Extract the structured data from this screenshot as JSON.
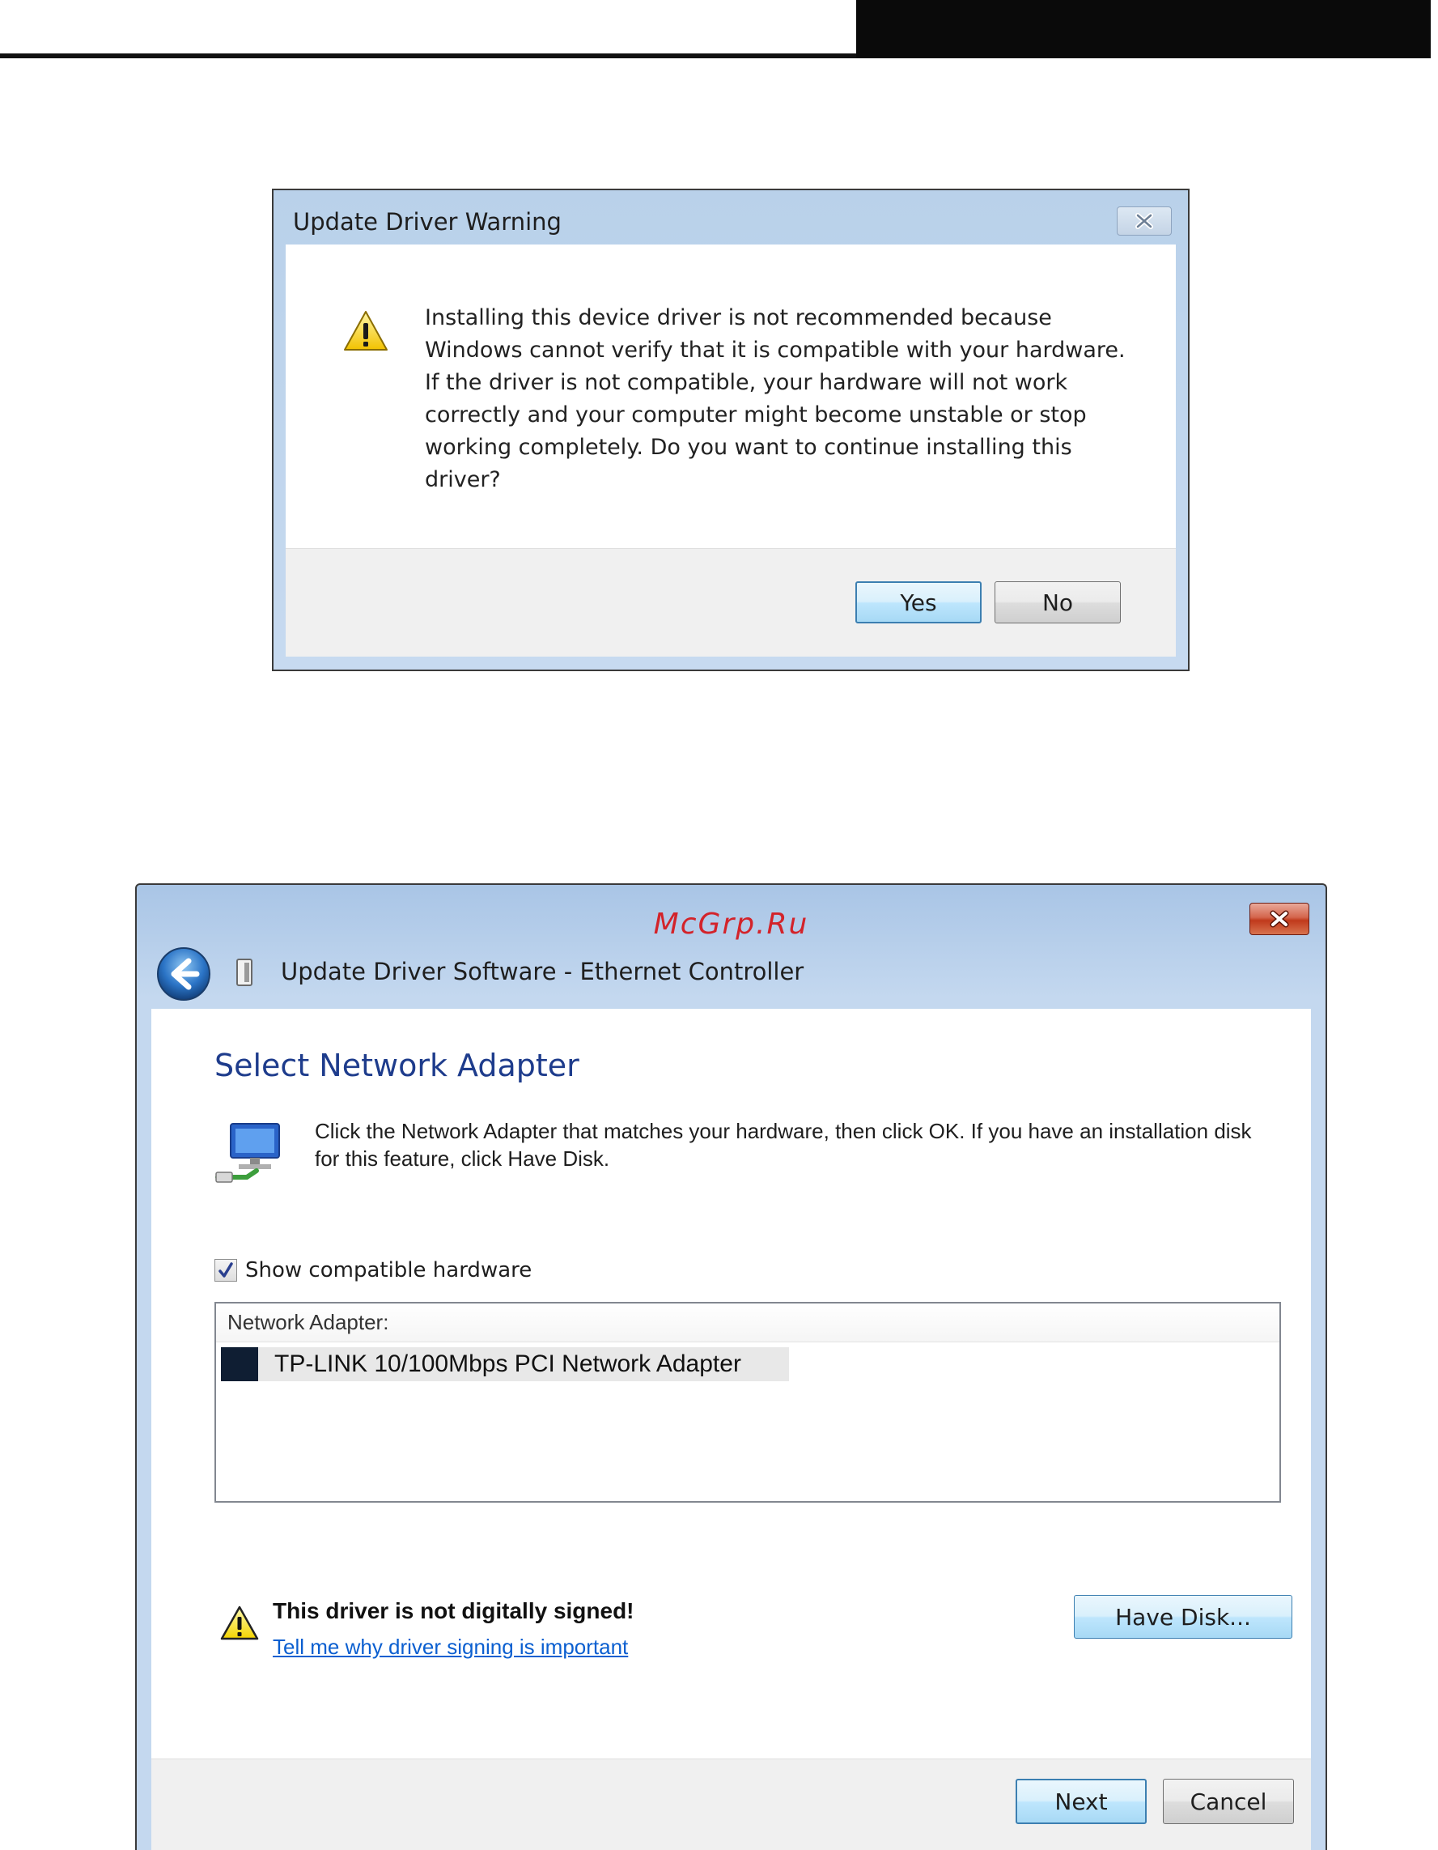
{
  "warning_dialog": {
    "title": "Update Driver Warning",
    "message": "Installing this device driver is not recommended because Windows cannot verify that it is compatible with your hardware. If the driver is not compatible, your hardware will not work correctly and your computer might become unstable or stop working completely.  Do you want to continue installing this driver?",
    "yes_label": "Yes",
    "no_label": "No",
    "icons": {
      "close": "close-icon",
      "warning": "warning-icon"
    }
  },
  "driver_dialog": {
    "watermark": "McGrp.Ru",
    "title": "Update Driver Software - Ethernet Controller",
    "heading": "Select Network Adapter",
    "instructions": "Click the Network Adapter that matches your hardware, then click OK. If you have an installation disk for this feature, click Have Disk.",
    "show_compatible_label": "Show compatible hardware",
    "show_compatible_checked": true,
    "list_header": "Network Adapter:",
    "adapters": [
      "TP-LINK 10/100Mbps PCI Network Adapter"
    ],
    "unsigned_warning": "This driver is not digitally signed!",
    "signing_link": "Tell me why driver signing is important",
    "have_disk_label": "Have Disk...",
    "next_label": "Next",
    "cancel_label": "Cancel",
    "icons": {
      "close": "close-icon",
      "back": "back-arrow-icon",
      "device": "device-icon",
      "network": "network-adapter-icon",
      "warning": "warning-icon",
      "checkmark": "checkmark-icon"
    },
    "colors": {
      "heading": "#1e3c8c",
      "link": "#0b5fd0",
      "close_button": "#c0391b",
      "selected_swatch": "#0f1e33"
    }
  }
}
